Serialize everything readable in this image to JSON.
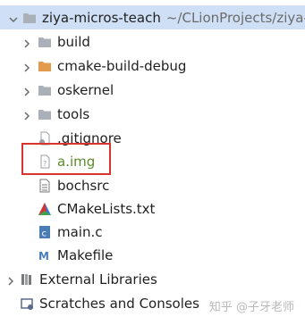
{
  "root": {
    "name": "ziya-micros-teach",
    "path": "~/CLionProjects/ziya-m"
  },
  "items": [
    {
      "label": "build"
    },
    {
      "label": "cmake-build-debug"
    },
    {
      "label": "oskernel"
    },
    {
      "label": "tools"
    },
    {
      "label": ".gitignore"
    },
    {
      "label": "a.img"
    },
    {
      "label": "bochsrc"
    },
    {
      "label": "CMakeLists.txt"
    },
    {
      "label": "main.c"
    },
    {
      "label": "Makefile"
    }
  ],
  "external_libraries": {
    "label": "External Libraries"
  },
  "scratches": {
    "label": "Scratches and Consoles"
  },
  "watermark": "知乎 @子牙老师",
  "colors": {
    "folder": "#a9b0b7",
    "folder_orange": "#e39a4c",
    "selection": "#cfe0f6",
    "highlight_box": "#d8332f",
    "cmake": "#2f7bd6",
    "c_file": "#4a7db6"
  }
}
